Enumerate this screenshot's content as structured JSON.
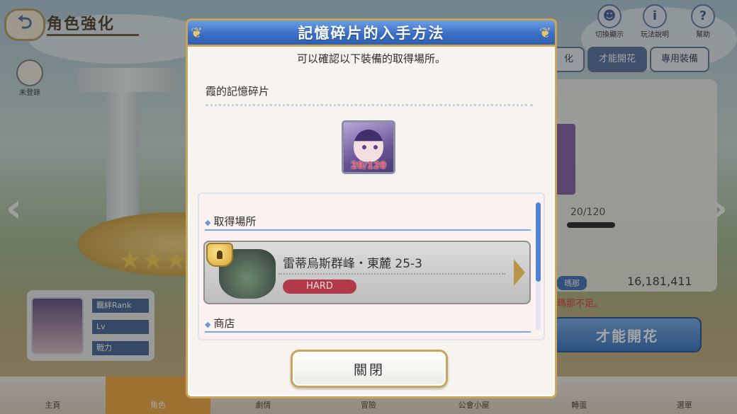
{
  "background": {
    "page_title": "角色強化",
    "back_label": "⮌",
    "top_icons": [
      {
        "name": "toggle-display",
        "label": "切換顯示"
      },
      {
        "name": "help-info",
        "label": "玩法說明"
      },
      {
        "name": "help",
        "label": "幫助"
      }
    ],
    "side_icon_label": "未登錄",
    "tabs": [
      "化",
      "才能開花",
      "專用裝備"
    ],
    "shard_count": "20/120",
    "money_label": "瑪那",
    "money": "16,181,411",
    "warning": "瑪那不足。",
    "bloom_button": "才能開花",
    "char_stats": [
      "羈絆Rank",
      "Lv",
      "戰力"
    ],
    "nav": [
      "主頁",
      "角色",
      "劇情",
      "冒險",
      "公會小屋",
      "轉蛋",
      "選單"
    ]
  },
  "modal": {
    "title": "記憶碎片的入手方法",
    "subtitle": "可以確認以下裝備的取得場所。",
    "item_name": "霞的記憶碎片",
    "item_count": "20/120",
    "sections": {
      "acquire_label": "取得場所",
      "shop_label": "商店"
    },
    "location": {
      "name": "雷蒂烏斯群峰・東麓 25-3",
      "difficulty": "HARD"
    },
    "close_label": "關閉"
  },
  "colors": {
    "header_blue": "#3b6fc4",
    "gold_border": "#c9a45a",
    "hard_red": "#b23a48",
    "count_red": "#e64f5f"
  }
}
